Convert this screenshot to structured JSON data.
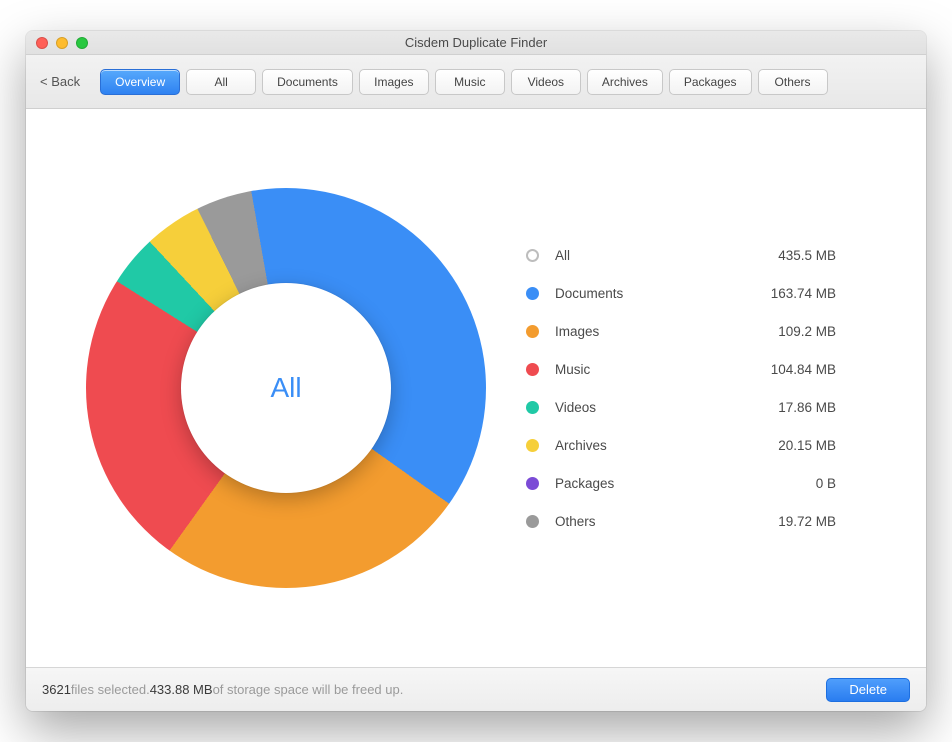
{
  "window_title": "Cisdem Duplicate Finder",
  "back_label": "< Back",
  "tabs": [
    "Overview",
    "All",
    "Documents",
    "Images",
    "Music",
    "Videos",
    "Archives",
    "Packages",
    "Others"
  ],
  "active_tab": 0,
  "center_label": "All",
  "legend": [
    {
      "label": "All",
      "value_text": "435.5 MB",
      "color": "#ffffff",
      "ring": true
    },
    {
      "label": "Documents",
      "value_text": "163.74 MB",
      "color": "#3a8ef6"
    },
    {
      "label": "Images",
      "value_text": "109.2 MB",
      "color": "#f39c2f"
    },
    {
      "label": "Music",
      "value_text": "104.84 MB",
      "color": "#ef4b50"
    },
    {
      "label": "Videos",
      "value_text": "17.86 MB",
      "color": "#20c9a6"
    },
    {
      "label": "Archives",
      "value_text": "20.15 MB",
      "color": "#f6cf3a"
    },
    {
      "label": "Packages",
      "value_text": "0 B",
      "color": "#7b4bd6"
    },
    {
      "label": "Others",
      "value_text": "19.72 MB",
      "color": "#9a9a9a"
    }
  ],
  "chart_data": {
    "type": "pie",
    "title": "All",
    "categories": [
      "Documents",
      "Images",
      "Music",
      "Videos",
      "Archives",
      "Packages",
      "Others"
    ],
    "values": [
      163.74,
      109.2,
      104.84,
      17.86,
      20.15,
      0,
      19.72
    ],
    "unit": "MB",
    "total_label": "All",
    "total_value": 435.5,
    "colors": [
      "#3a8ef6",
      "#f39c2f",
      "#ef4b50",
      "#20c9a6",
      "#f6cf3a",
      "#7b4bd6",
      "#9a9a9a"
    ]
  },
  "footer": {
    "count": "3621",
    "text_after_count": " files selected. ",
    "size": "433.88 MB",
    "text_after_size": " of storage space will be freed up.",
    "delete_label": "Delete"
  }
}
